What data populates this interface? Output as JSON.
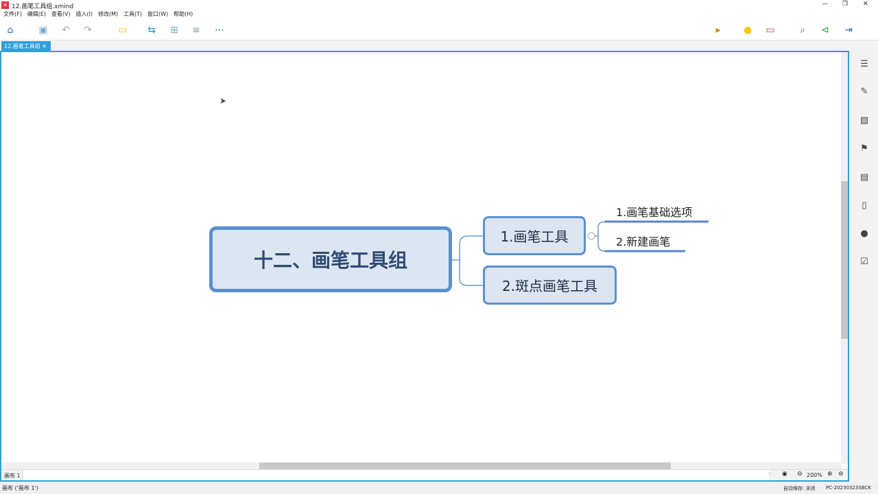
{
  "window": {
    "title": "12.画笔工具组.xmind"
  },
  "menu": [
    "文件(F)",
    "编辑(E)",
    "查看(V)",
    "插入(I)",
    "修改(M)",
    "工具(T)",
    "窗口(W)",
    "帮助(H)"
  ],
  "tab": {
    "label": "12.画笔工具组",
    "close": "✕"
  },
  "mindmap": {
    "central": "十二、画笔工具组",
    "topics": [
      {
        "label": "1.画笔工具",
        "subtopics": [
          "1.画笔基础选项",
          "2.新建画笔"
        ]
      },
      {
        "label": "2.斑点画笔工具"
      }
    ]
  },
  "bottom": {
    "sheet_label": "画布 1",
    "zoom": "200%"
  },
  "status": {
    "left": "画布 ('画布 1')",
    "autosave": "自动保存: 关闭",
    "pc": "PC-20230323SBCK"
  }
}
